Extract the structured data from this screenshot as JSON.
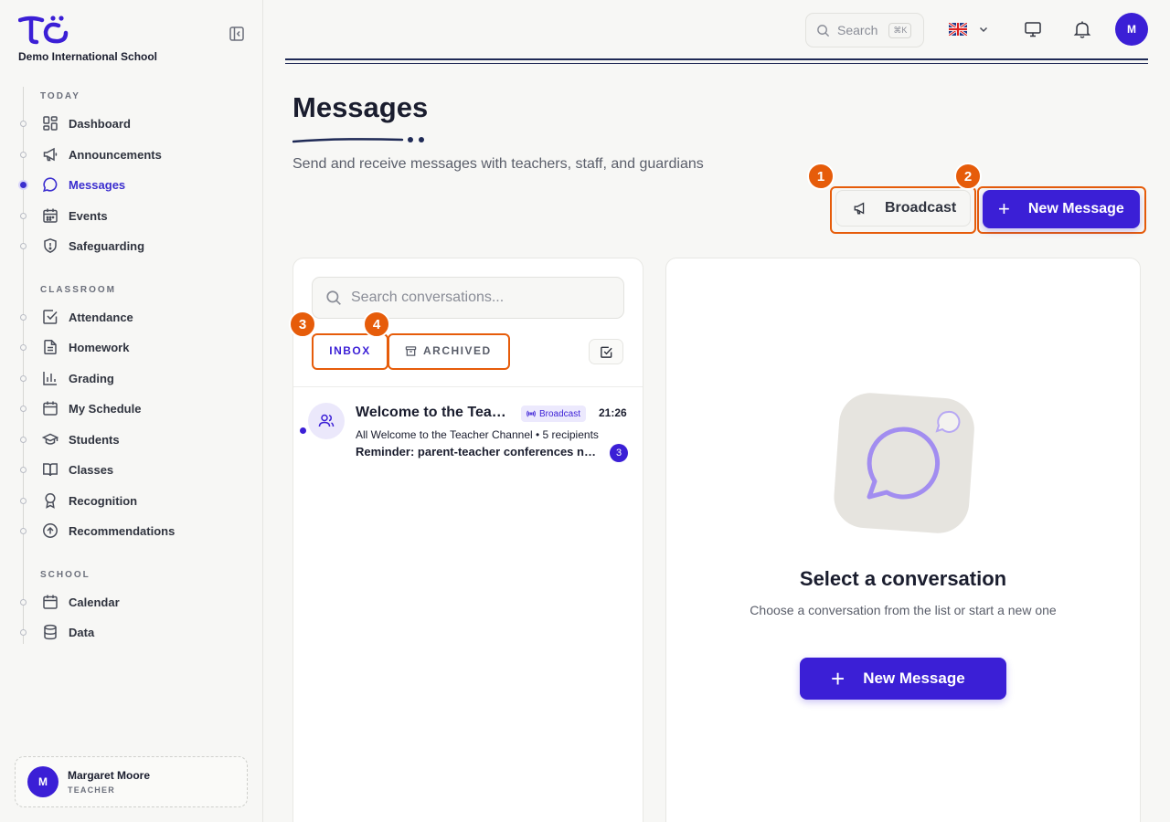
{
  "app": {
    "school_name": "Demo International School",
    "brand_color": "#3b1fd6",
    "highlight_color": "#e65c0a"
  },
  "sidebar": {
    "sections": [
      {
        "title": "TODAY"
      },
      {
        "title": "CLASSROOM"
      },
      {
        "title": "SCHOOL"
      }
    ],
    "items": [
      {
        "label": "Dashboard",
        "icon": "dashboard-icon"
      },
      {
        "label": "Announcements",
        "icon": "megaphone-icon"
      },
      {
        "label": "Messages",
        "icon": "message-icon",
        "active": true
      },
      {
        "label": "Events",
        "icon": "calendar-icon"
      },
      {
        "label": "Safeguarding",
        "icon": "shield-icon"
      },
      {
        "label": "Attendance",
        "icon": "checkbox-icon"
      },
      {
        "label": "Homework",
        "icon": "document-icon"
      },
      {
        "label": "Grading",
        "icon": "bar-chart-icon"
      },
      {
        "label": "My Schedule",
        "icon": "calendar-icon"
      },
      {
        "label": "Students",
        "icon": "graduation-cap-icon"
      },
      {
        "label": "Classes",
        "icon": "book-icon"
      },
      {
        "label": "Recognition",
        "icon": "award-icon"
      },
      {
        "label": "Recommendations",
        "icon": "arrow-up-circle-icon"
      },
      {
        "label": "Calendar",
        "icon": "calendar-icon"
      },
      {
        "label": "Data",
        "icon": "database-icon"
      }
    ],
    "user": {
      "initial": "M",
      "name": "Margaret Moore",
      "role": "TEACHER"
    }
  },
  "topbar": {
    "search_label": "Search",
    "search_shortcut": "⌘K",
    "language_icon": "uk-flag-icon",
    "avatar_initial": "M"
  },
  "header": {
    "title": "Messages",
    "subtitle": "Send and receive messages with teachers, staff, and guardians",
    "broadcast_label": "Broadcast",
    "new_message_label": "New Message"
  },
  "badges": [
    "1",
    "2",
    "3",
    "4"
  ],
  "conversations": {
    "search_placeholder": "Search conversations...",
    "tabs": {
      "inbox": "INBOX",
      "archived": "ARCHIVED"
    },
    "items": [
      {
        "title": "Welcome to the Teacher Channel",
        "tag": "Broadcast",
        "time": "21:26",
        "meta": "All Welcome to the Teacher Channel • 5 recipients",
        "preview": "Reminder: parent-teacher conferences next week",
        "unread_count": "3"
      }
    ]
  },
  "empty_state": {
    "title": "Select a conversation",
    "subtitle": "Choose a conversation from the list or start a new one",
    "button_label": "New Message"
  }
}
